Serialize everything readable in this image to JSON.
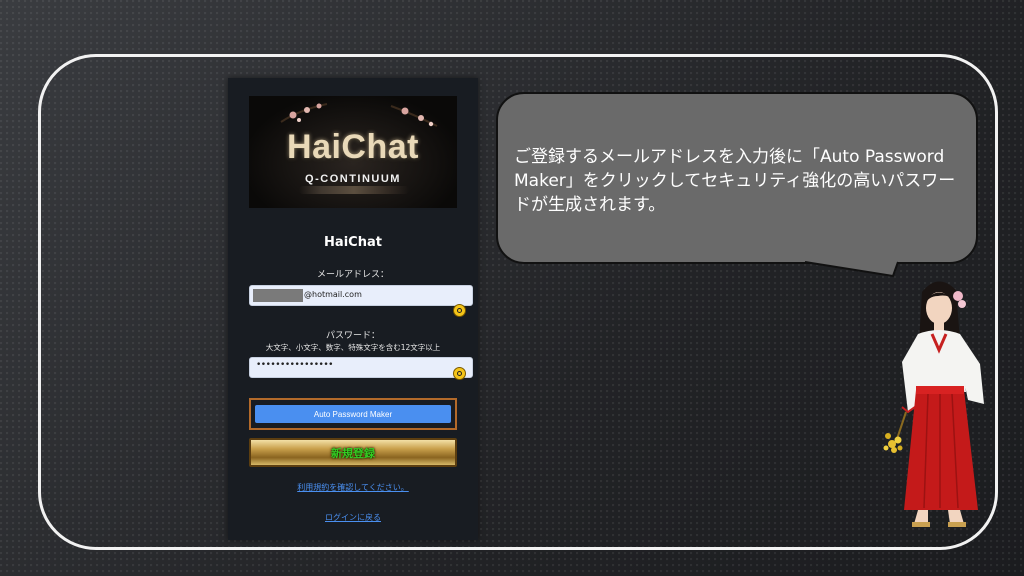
{
  "logo": {
    "title": "HaiChat",
    "subtitle": "Q-CONTINUUM"
  },
  "form": {
    "app_title": "HaiChat",
    "email_label": "メールアドレス：",
    "email_value": "@hotmail.com",
    "password_label": "パスワード：",
    "password_hint": "大文字、小文字、数字、特殊文字を含む12文字以上",
    "password_value": "••••••••••••••••",
    "auto_password_button": "Auto Password Maker",
    "register_button": "新規登録",
    "terms_link": "利用規約を確認してください。",
    "login_link": "ログインに戻る"
  },
  "bubble": {
    "text": "ご登録するメールアドレスを入力後に「Auto Password Maker」をクリックしてセキュリティ強化の高いパスワードが生成されます。"
  },
  "icons": {
    "key_icons": [
      "key-icon",
      "key-icon"
    ]
  },
  "colors": {
    "accent_blue": "#4a8ff0",
    "register_text": "#33cc22",
    "frame_orange": "#b36a2a",
    "panel_bg": "#181c22",
    "bubble_bg": "#6a6a6a"
  }
}
